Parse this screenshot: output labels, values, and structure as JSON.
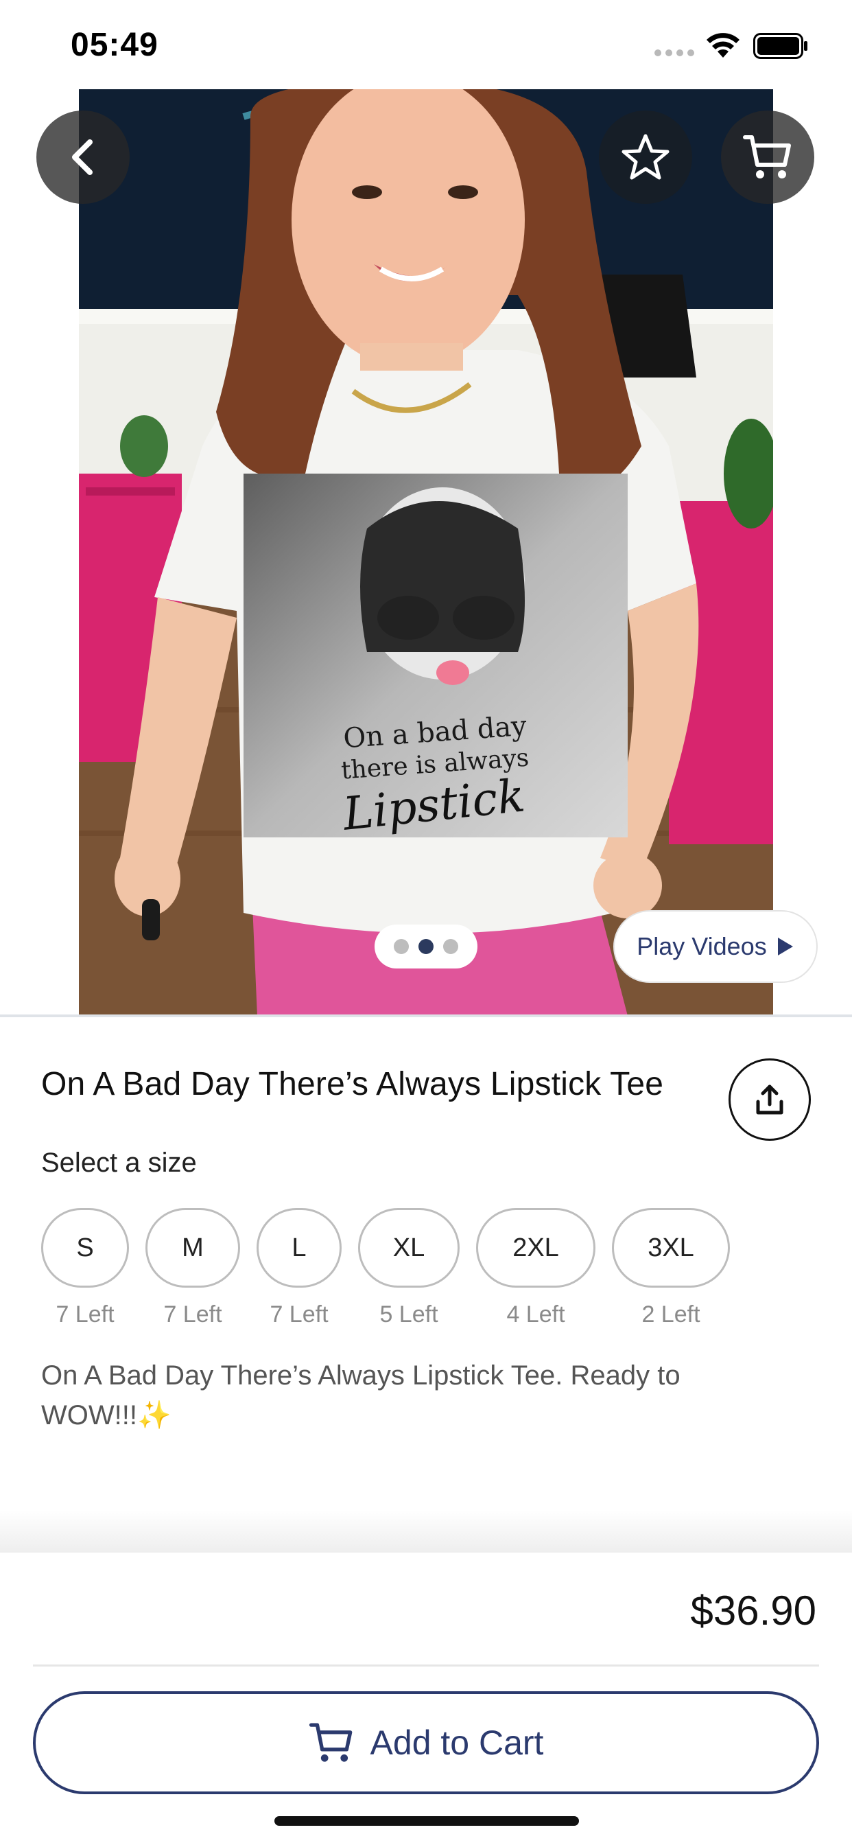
{
  "status_bar": {
    "time": "05:49"
  },
  "header": {
    "back_icon": "chevron-left-icon",
    "favorite_icon": "star-icon",
    "cart_icon": "cart-icon"
  },
  "gallery": {
    "image_count": 3,
    "active_index": 1,
    "play_videos_label": "Play Videos",
    "shirt_print_text": [
      "On a bad day",
      "there is always",
      "Lipstick"
    ]
  },
  "product": {
    "title": "On A Bad Day There’s Always Lipstick Tee",
    "size_heading": "Select a size",
    "sizes": [
      {
        "label": "S",
        "stock": "7 Left"
      },
      {
        "label": "M",
        "stock": "7 Left"
      },
      {
        "label": "L",
        "stock": "7 Left"
      },
      {
        "label": "XL",
        "stock": "5 Left"
      },
      {
        "label": "2XL",
        "stock": "4 Left"
      },
      {
        "label": "3XL",
        "stock": "2 Left"
      }
    ],
    "description": "On A Bad Day There’s Always Lipstick Tee. Ready to WOW!!!✨"
  },
  "footer": {
    "price": "$36.90",
    "add_to_cart_label": "Add to Cart"
  },
  "colors": {
    "accent": "#2b3a6e",
    "pants_pink": "#e0559a",
    "furniture_pink": "#d8256e",
    "background_navy": "#0f1f33"
  }
}
